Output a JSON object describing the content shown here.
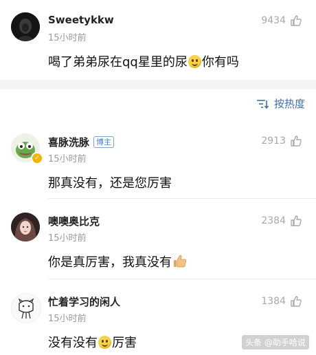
{
  "comments": [
    {
      "username": "Sweetykkw",
      "time": "15小时前",
      "likes": "9434",
      "text_before": "喝了弟弟尿在qq星里的尿",
      "text_after": "你有吗",
      "avatar_icon": "dark-hooded-figure-avatar"
    },
    {
      "username": "喜脉洗脉",
      "badge": "博主",
      "time": "15小时前",
      "likes": "2913",
      "text": "那真没有，还是您厉害",
      "avatar_icon": "green-frog-avatar"
    },
    {
      "username": "噢噢奥比克",
      "time": "15小时前",
      "likes": "2384",
      "text": "你是真厉害，我真没有",
      "avatar_icon": "girl-portrait-avatar"
    },
    {
      "username": "忙着学习的闲人",
      "time": "15小时前",
      "likes": "1384",
      "text_before": "没有没有",
      "text_after": "厉害",
      "avatar_icon": "cartoon-doodle-avatar"
    }
  ],
  "sort": {
    "label": "按热度",
    "icon": "sort-lines-icon"
  },
  "watermark": "头条 @助手哈说",
  "colors": {
    "link_blue": "#3f6fa8",
    "muted_gray": "#9a9a9a",
    "band_gray": "#f3f3f3"
  }
}
